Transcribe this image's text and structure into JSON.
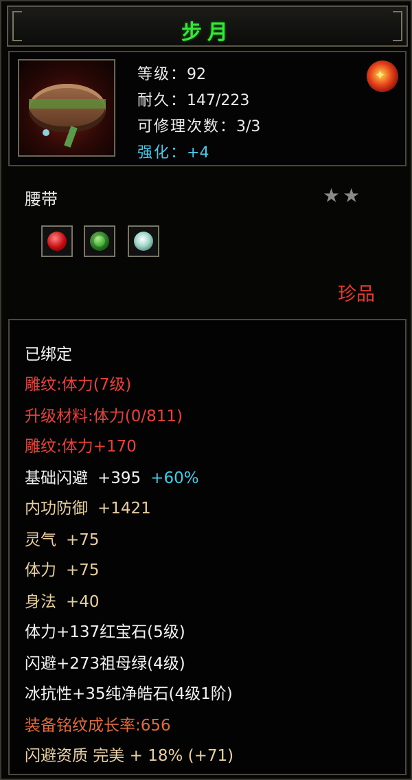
{
  "title": "步月",
  "header": {
    "level_label": "等级：",
    "level_value": "92",
    "durability_label": "耐久：",
    "durability_value": "147/223",
    "repairs_label": "可修理次数：",
    "repairs_value": "3/3",
    "enhance_label": "强化：",
    "enhance_value": "+4",
    "emblem_icon": "fire-dragon-emblem-icon",
    "item_icon": "belt-icon"
  },
  "item": {
    "type": "腰带",
    "stars": "★★",
    "rarity": "珍品",
    "gems": [
      "ruby-gem-icon",
      "emerald-gem-icon",
      "diamond-gem-icon"
    ]
  },
  "stats": {
    "bound": "已绑定",
    "engrave": "雕纹:体力(7级)",
    "upgrade_material": "升级材料:体力(0/811)",
    "engrave_bonus": "雕纹:体力+170",
    "dodge_label": "基础闪避",
    "dodge_value": "+395",
    "dodge_bonus": "+60%",
    "inner_defense_label": "内功防御",
    "inner_defense_value": "+1421",
    "spirit_label": "灵气",
    "spirit_value": "+75",
    "stamina_label": "体力",
    "stamina_value": "+75",
    "agility_label": "身法",
    "agility_value": "+40",
    "gem_line_1": "体力+137红宝石(5级)",
    "gem_line_2": "闪避+273祖母绿(4级)",
    "gem_line_3": "冰抗性+35纯净皓石(4级1阶)",
    "growth": "装备铭纹成长率:656",
    "quality": "闪避资质 完美 + 18% (+71)"
  },
  "colors": {
    "title_green": "#38e63a",
    "red": "#e8413a",
    "tan": "#e9cfa0",
    "cyan": "#42cde6",
    "orange": "#e26a3c"
  }
}
